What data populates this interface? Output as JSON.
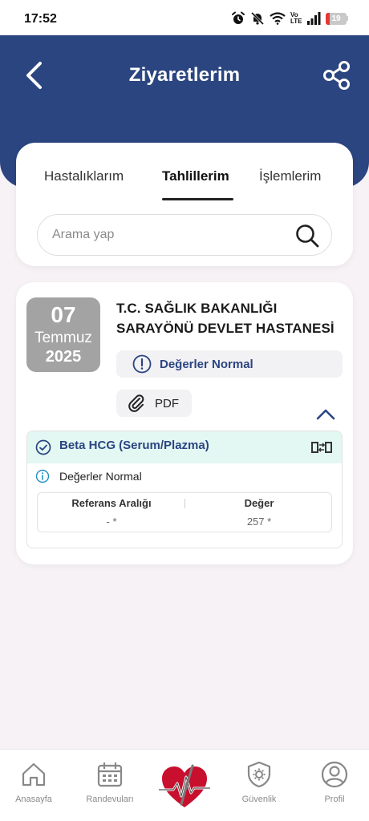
{
  "status_bar": {
    "time": "17:52",
    "battery_level": 19,
    "battery_text": "19",
    "network_label": "Vo LTE",
    "icons": [
      "alarm-icon",
      "mute-icon",
      "wifi-icon",
      "volte-icon",
      "signal-icon",
      "battery-icon"
    ]
  },
  "header": {
    "title": "Ziyaretlerim",
    "back_icon": "chevron-left-icon",
    "share_icon": "share-icon"
  },
  "tabs": [
    {
      "label": "Hastalıklarım",
      "active": false
    },
    {
      "label": "Tahlillerim",
      "active": true
    },
    {
      "label": "İşlemlerim",
      "active": false
    }
  ],
  "search": {
    "placeholder": "Arama yap",
    "value": ""
  },
  "visit": {
    "date": {
      "day": "07",
      "month": "Temmuz",
      "year": "2025"
    },
    "hospital": "T.C. SAĞLIK BAKANLIĞI SARAYÖNÜ DEVLET HASTANESİ",
    "status": "Değerler Normal",
    "pdf_label": "PDF",
    "expanded": true
  },
  "test": {
    "name": "Beta HCG (Serum/Plazma)",
    "status": "Değerler Normal",
    "table": {
      "headers": [
        "Referans Aralığı",
        "Değer"
      ],
      "values": [
        "- *",
        "257 *"
      ]
    }
  },
  "bottom_nav": [
    {
      "label": "Anasayfa",
      "icon": "home-icon"
    },
    {
      "label": "Randevuları",
      "icon": "calendar-icon"
    },
    {
      "label": "",
      "icon": "e-nabiz-heart-logo"
    },
    {
      "label": "Güvenlik",
      "icon": "shield-gear-icon"
    },
    {
      "label": "Profil",
      "icon": "user-icon"
    }
  ],
  "colors": {
    "primary": "#2b4581",
    "background": "#f6f2f5",
    "test_header": "#e3f7f3",
    "date_badge": "#a3a3a3",
    "battery_low": "#e53935"
  }
}
